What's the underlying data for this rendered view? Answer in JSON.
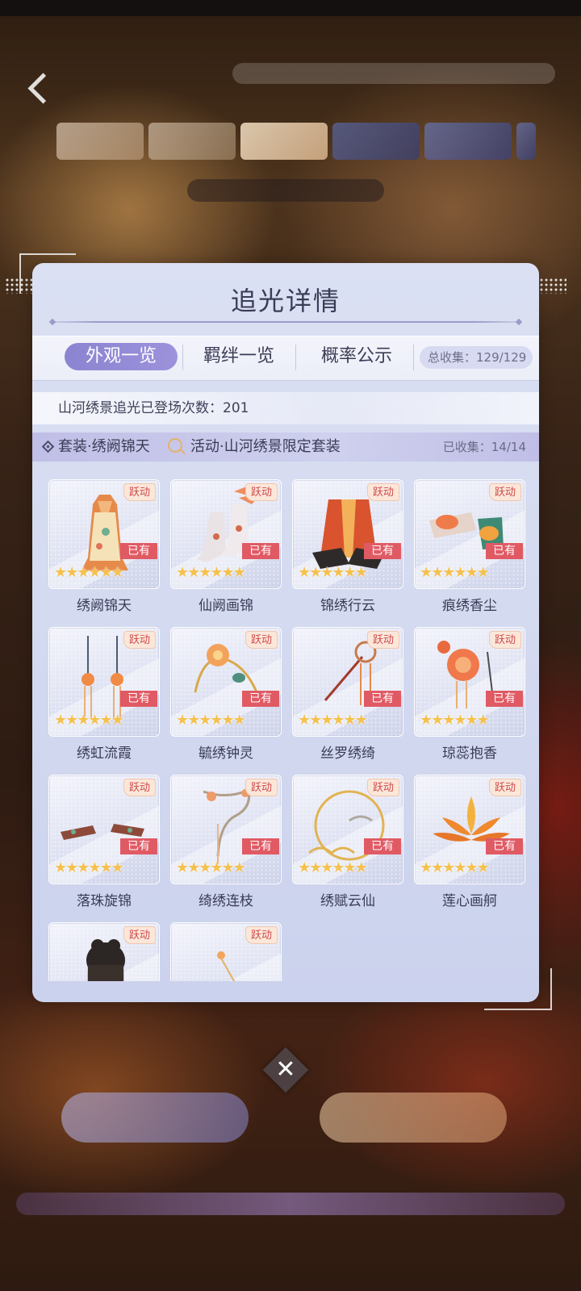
{
  "panel": {
    "title": "追光详情",
    "tabs": [
      {
        "label": "外观一览",
        "active": true
      },
      {
        "label": "羁绊一览",
        "active": false
      },
      {
        "label": "概率公示",
        "active": false
      }
    ],
    "total_collect": "总收集：129/129",
    "appear_count": "山河绣景追光已登场次数：201",
    "set_name": "套装·绣阙锦天",
    "set_activity": "活动·山河绣景限定套装",
    "set_collected": "已收集：14/14"
  },
  "badges": {
    "active": "跃动",
    "owned": "已有",
    "stars": "★★★★★★"
  },
  "items": [
    {
      "name": "绣阙锦天",
      "icon": "dress-icon"
    },
    {
      "name": "仙阙画锦",
      "icon": "boots-icon"
    },
    {
      "name": "锦绣行云",
      "icon": "robe-icon"
    },
    {
      "name": "痕绣香尘",
      "icon": "shoes-icon"
    },
    {
      "name": "绣虹流霞",
      "icon": "earrings-icon"
    },
    {
      "name": "毓绣钟灵",
      "icon": "flower-ornament-icon"
    },
    {
      "name": "丝罗绣绮",
      "icon": "hairpin-icon"
    },
    {
      "name": "琼蕊抱香",
      "icon": "peony-hairpin-icon"
    },
    {
      "name": "落珠旋锦",
      "icon": "wristbands-icon"
    },
    {
      "name": "绮绣连枝",
      "icon": "branch-hairpin-icon"
    },
    {
      "name": "绣赋云仙",
      "icon": "moon-cloud-icon"
    },
    {
      "name": "莲心画舸",
      "icon": "lotus-icon"
    },
    {
      "name": "",
      "icon": "hair-icon"
    },
    {
      "name": "",
      "icon": "sparkle-icon"
    }
  ],
  "colors": {
    "tab_active": "#8b84d0",
    "owned_badge": "#e05a64",
    "star": "#f5c14e"
  }
}
